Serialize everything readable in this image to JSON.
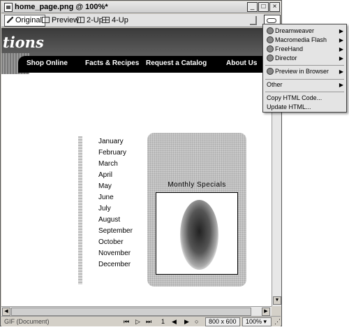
{
  "window": {
    "title": "home_page.png @ 100%*",
    "minimize_glyph": "_",
    "maximize_glyph": "□",
    "close_glyph": "×"
  },
  "toolbar": {
    "tabs": [
      {
        "label": "Original",
        "active": true
      },
      {
        "label": "Preview",
        "active": false
      },
      {
        "label": "2-Up",
        "active": false
      },
      {
        "label": "4-Up",
        "active": false
      }
    ]
  },
  "page": {
    "banner_text": "tions",
    "nav": [
      "Shop Online",
      "Facts & Recipes",
      "Request a Catalog",
      "About Us"
    ],
    "months": [
      "January",
      "February",
      "March",
      "April",
      "May",
      "June",
      "July",
      "August",
      "September",
      "October",
      "November",
      "December"
    ],
    "specials_title": "Monthly Specials"
  },
  "popup_menu": {
    "items": [
      {
        "label": "Dreamweaver",
        "submenu": true
      },
      {
        "label": "Macromedia Flash",
        "submenu": true
      },
      {
        "label": "FreeHand",
        "submenu": true
      },
      {
        "label": "Director",
        "submenu": true
      },
      {
        "label": "Preview in Browser",
        "submenu": true
      },
      {
        "label": "Other",
        "submenu": true
      },
      {
        "label": "Copy HTML Code...",
        "submenu": false
      },
      {
        "label": "Update HTML...",
        "submenu": false
      }
    ],
    "submenu_glyph": "▶"
  },
  "status": {
    "format": "GIF (Document)",
    "frame": "1",
    "dimensions": "800 x 600",
    "zoom": "100%"
  },
  "icons": {
    "first_frame": "⏮",
    "play": "▷",
    "last_frame": "⏭",
    "prev_frame": "◀",
    "next_frame": "▶",
    "loop": "○",
    "scroll_up": "▲",
    "scroll_down": "▼",
    "scroll_left": "◀",
    "scroll_right": "▶",
    "dropdown": "▾",
    "resize_grip": "⋰"
  }
}
